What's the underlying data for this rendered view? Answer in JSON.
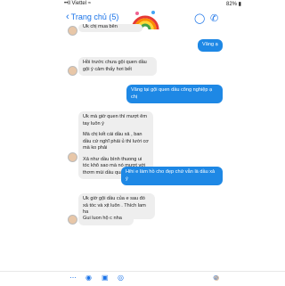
{
  "status": {
    "carrier": "••ll Viettel ≈",
    "time": "",
    "battery": "82% ▮"
  },
  "nav": {
    "back_label": "Trang chủ (5)"
  },
  "messages": {
    "m0": "Uk chị mua bên",
    "m1": "Vâng ạ",
    "m2": "Hồi trước chưa gội quen dầu gội ý cảm thấy hơi bết",
    "m3": "Vâng tại gội quen dầu công nghiệp ạ chị",
    "m4a": "Uk mà giờ quen thì mượt êm tay luôn ý",
    "m4b": "Mà chị kết cái dầu xả , ban dầu cứ nghĩ phải ủ thì lười cơ mà ko phải",
    "m4c": "Xả như dầu bình thuong ui tóc khô sao mà nó mượt với thơm mùi dầu quá đi mất",
    "m5": "Hihi e làm hồ cho đẹp chứ vẫn là dầu xả ý",
    "m6": "Uk giờ gội dầu của e sau đó xả tóc và xịt luôn . Thích lam ha",
    "m7": "Gui luon hộ c nha"
  }
}
